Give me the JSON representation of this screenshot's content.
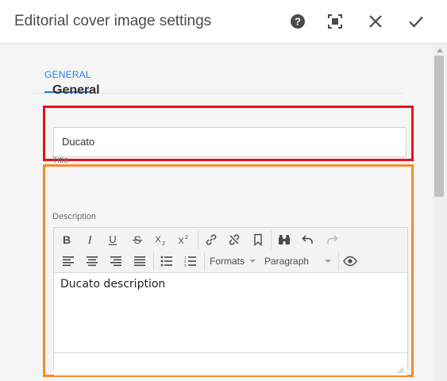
{
  "dialog": {
    "title": "Editorial cover image settings",
    "icons": {
      "help": "help-icon",
      "fullscreen": "fullscreen-icon",
      "close": "close-icon",
      "confirm": "checkmark-icon"
    }
  },
  "tabs": [
    {
      "label": "GENERAL",
      "active": true
    }
  ],
  "section": {
    "title": "General"
  },
  "fields": {
    "title": {
      "label": "Title",
      "value": "Ducato"
    },
    "description": {
      "label": "Description",
      "value": "Ducato description",
      "toolbar": {
        "row1": [
          "bold-icon",
          "italic-icon",
          "underline-icon",
          "strikethrough-icon",
          "subscript-icon",
          "superscript-icon",
          "link-icon",
          "unlink-icon",
          "anchor-icon",
          "find-replace-icon",
          "undo-icon",
          "redo-icon"
        ],
        "row2": [
          "align-left-icon",
          "align-center-icon",
          "align-right-icon",
          "justify-icon",
          "bulleted-list-icon",
          "numbered-list-icon",
          "eye-icon"
        ],
        "formats_label": "Formats",
        "paragraph_label": "Paragraph"
      }
    }
  },
  "colors": {
    "accent": "#2680eb",
    "highlight_title": "#e3141b",
    "highlight_description": "#f68b29"
  }
}
